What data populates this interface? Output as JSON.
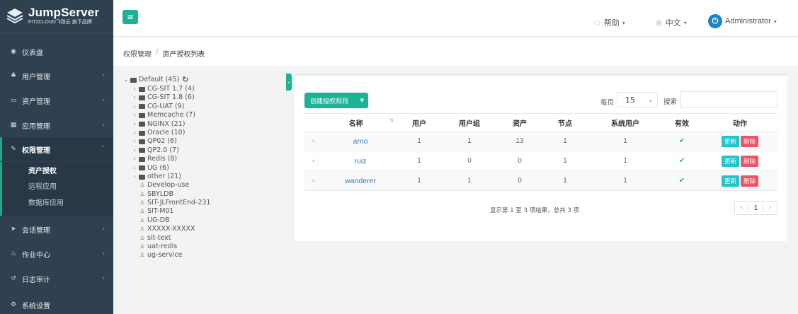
{
  "brand": {
    "title": "JumpServer",
    "subtitle": "FIT2CLOUD飞致云 旗下品牌",
    "accent_color": "#1ab394",
    "sidebar_color": "#2f4050"
  },
  "sidebar": {
    "items": [
      {
        "label": "仪表盘",
        "icon": "dashboard-icon",
        "glyph": "◉"
      },
      {
        "label": "用户管理",
        "icon": "users-icon",
        "glyph": "♣",
        "chevron": "‹"
      },
      {
        "label": "资产管理",
        "icon": "inbox-icon",
        "glyph": "▭",
        "chevron": "‹"
      },
      {
        "label": "应用管理",
        "icon": "grid-icon",
        "glyph": "▦",
        "chevron": "‹"
      },
      {
        "label": "权限管理",
        "icon": "edit-icon",
        "glyph": "✎",
        "chevron": "ˇ"
      },
      {
        "label": "会话管理",
        "icon": "rocket-icon",
        "glyph": "➤",
        "chevron": "‹"
      },
      {
        "label": "作业中心",
        "icon": "coffee-icon",
        "glyph": "♨",
        "chevron": "‹"
      },
      {
        "label": "日志审计",
        "icon": "history-icon",
        "glyph": "↺",
        "chevron": "‹"
      },
      {
        "label": "系统设置",
        "icon": "gears-icon",
        "glyph": "⚙"
      }
    ],
    "sub_items": [
      {
        "label": "资产授权"
      },
      {
        "label": "远程应用"
      },
      {
        "label": "数据库应用"
      }
    ]
  },
  "topbar": {
    "menu_glyph": "≡",
    "help": "帮助",
    "lang": "中文",
    "user": "Administrator",
    "avatar_glyph": "⏻"
  },
  "breadcrumb": {
    "parent": "权限管理",
    "sep": "/",
    "current": "资产授权列表"
  },
  "tree": {
    "root": "Default (45)",
    "folders": [
      "CG-SIT 1.7 (4)",
      "CG-SIT 1.8 (6)",
      "CG-UAT (9)",
      "Memcache (7)",
      "NGINX (21)",
      "Oracle (10)",
      "QP02 (6)",
      "QP2.0 (7)",
      "Redis (8)",
      "UG (6)",
      "other (21)"
    ],
    "assets": [
      "Develop-use",
      "SBYLDB",
      "SIT-JLFrontEnd-231",
      "SIT-M01",
      "UG-DB",
      "XXXXX-XXXXX",
      "sit-text",
      "uat-redis",
      "ug-service"
    ]
  },
  "toolbar": {
    "create_label": "创建授权规则",
    "per_page_label": "每页",
    "per_page_value": "15",
    "search_label": "搜索",
    "search_value": ""
  },
  "table": {
    "headers": [
      "",
      "名称",
      "用户",
      "用户组",
      "资产",
      "节点",
      "系统用户",
      "有效",
      "动作"
    ],
    "rows": [
      {
        "name": "arno",
        "users": "1",
        "groups": "1",
        "assets": "13",
        "nodes": "1",
        "system_users": "1"
      },
      {
        "name": "ruiz",
        "users": "1",
        "groups": "0",
        "assets": "0",
        "nodes": "1",
        "system_users": "1"
      },
      {
        "name": "wanderer",
        "users": "1",
        "groups": "1",
        "assets": "0",
        "nodes": "1",
        "system_users": "1"
      }
    ],
    "update_label": "更新",
    "delete_label": "删除",
    "valid_glyph": "✔",
    "expand_glyph": "›"
  },
  "footer": {
    "summary": "显示第 1 至 3 项结果，总共 3 项",
    "prev": "‹",
    "page": "1",
    "next": "›"
  }
}
